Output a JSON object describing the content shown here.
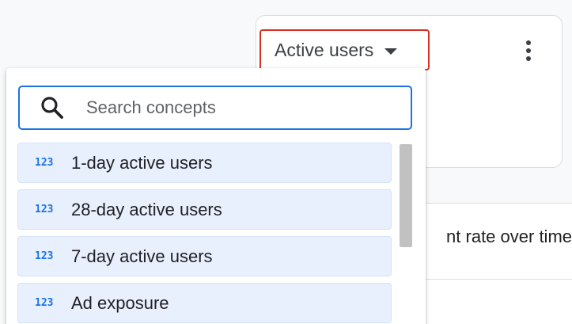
{
  "card": {
    "metric_label": "Active users"
  },
  "lower": {
    "title_partial": "nt rate over time"
  },
  "menu": {
    "search_placeholder": "Search concepts",
    "items": [
      {
        "icon": "123",
        "label": "1-day active users"
      },
      {
        "icon": "123",
        "label": "28-day active users"
      },
      {
        "icon": "123",
        "label": "7-day active users"
      },
      {
        "icon": "123",
        "label": "Ad exposure"
      }
    ]
  },
  "colors": {
    "accent": "#1a73e8",
    "highlight_border": "#d93025",
    "item_bg": "#e8f0fe"
  }
}
